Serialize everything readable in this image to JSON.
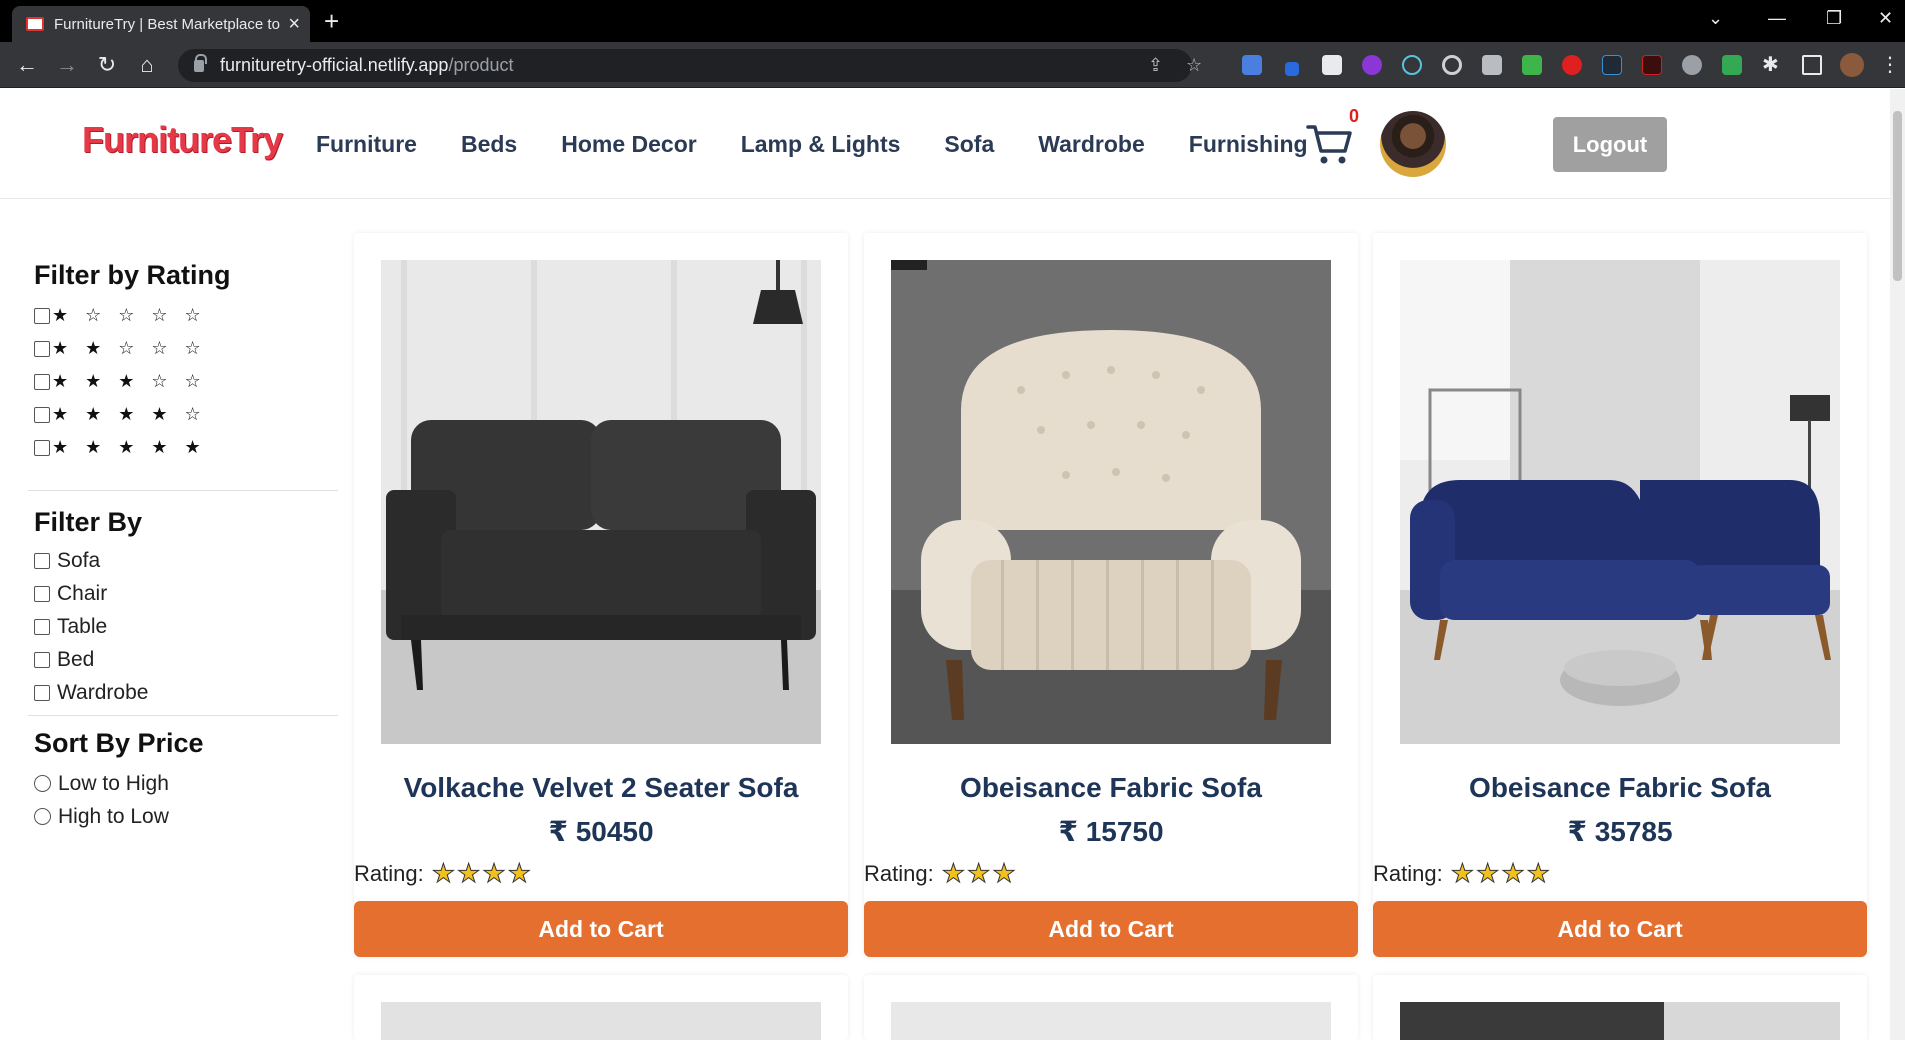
{
  "browser": {
    "tab_title": "FurnitureTry | Best Marketplace to",
    "url_host": "furnituretry-official.netlify.app",
    "url_path": "/product"
  },
  "site": {
    "logo": "FurnitureTry",
    "nav": [
      "Furniture",
      "Beds",
      "Home Decor",
      "Lamp & Lights",
      "Sofa",
      "Wardrobe",
      "Furnishing"
    ],
    "cart_count": "0",
    "logout_label": "Logout"
  },
  "sidebar": {
    "rating_heading": "Filter by Rating",
    "rating_options": [
      "★ ☆ ☆ ☆ ☆",
      "★ ★ ☆ ☆ ☆",
      "★ ★ ★ ☆ ☆",
      "★ ★ ★ ★ ☆",
      "★ ★ ★ ★ ★"
    ],
    "filter_heading": "Filter By",
    "categories": [
      "Sofa",
      "Chair",
      "Table",
      "Bed",
      "Wardrobe"
    ],
    "sort_heading": "Sort By Price",
    "sort_options": [
      "Low to High",
      "High to Low"
    ]
  },
  "products": [
    {
      "name": "Volkache Velvet 2 Seater Sofa",
      "price": "₹ 50450",
      "rating_label": "Rating:",
      "stars": "★★★★",
      "button": "Add to Cart"
    },
    {
      "name": "Obeisance Fabric Sofa",
      "price": "₹ 15750",
      "rating_label": "Rating:",
      "stars": "★★★",
      "button": "Add to Cart"
    },
    {
      "name": "Obeisance Fabric Sofa",
      "price": "₹ 35785",
      "rating_label": "Rating:",
      "stars": "★★★★",
      "button": "Add to Cart"
    }
  ],
  "colors": {
    "accent": "#e56f2e",
    "logo": "#e53948",
    "heading": "#1f3557"
  }
}
